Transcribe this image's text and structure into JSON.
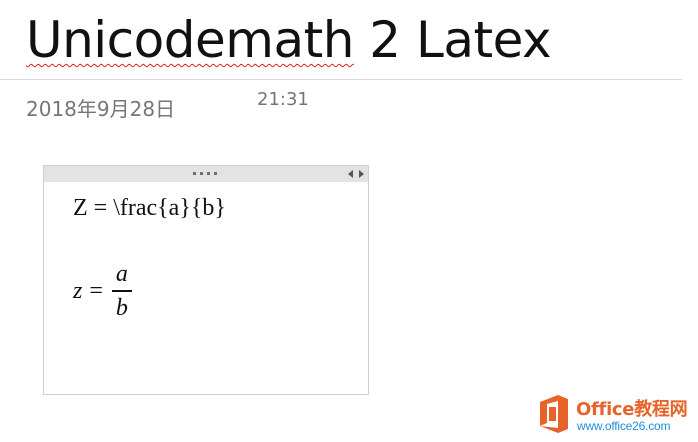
{
  "page": {
    "title_word_1": "Unicodemath",
    "title_rest": " 2 Latex",
    "date": "2018年9月28日",
    "time": "21:31"
  },
  "note": {
    "latex_equation": "Z = \\frac{a}{b}",
    "math_equation": {
      "lhs": "z",
      "operator": "=",
      "numerator": "a",
      "denominator": "b"
    }
  },
  "icons": {
    "handle": "drag-dots",
    "resize": "left-right-arrows",
    "watermark_logo": "office-logo"
  },
  "watermark": {
    "name": "Office教程网",
    "url": "www.office26.com"
  },
  "colors": {
    "spellcheck_underline": "#e02020",
    "metadata_text": "#767676",
    "watermark_orange": "#e8632a",
    "watermark_blue": "#1f8fd6"
  }
}
